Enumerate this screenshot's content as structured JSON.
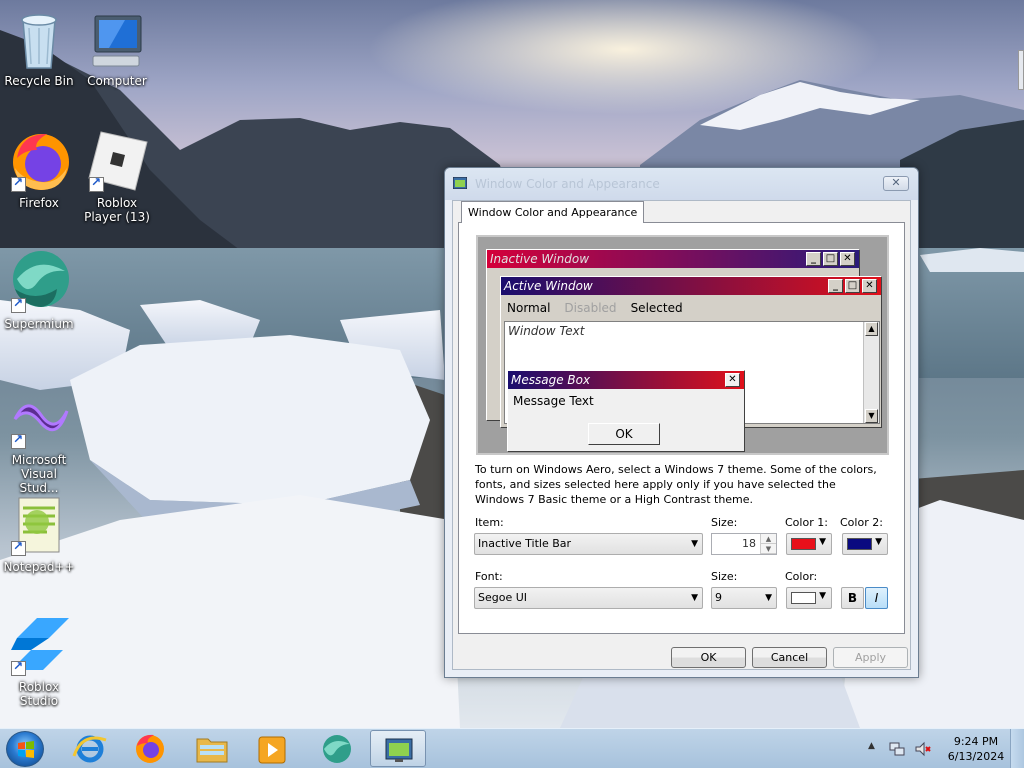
{
  "desktop": {
    "icons": [
      {
        "label": "Recycle Bin"
      },
      {
        "label": "Computer"
      },
      {
        "label": "Firefox"
      },
      {
        "label": "Roblox Player (13)"
      },
      {
        "label": "Supermium"
      },
      {
        "label": "Microsoft Visual Stud..."
      },
      {
        "label": "Notepad++"
      },
      {
        "label": "Roblox Studio"
      }
    ]
  },
  "dialog": {
    "title": "Window Color and Appearance",
    "tab_label": "Window Color and Appearance",
    "close_glyph": "✕",
    "preview": {
      "inactive_title": "Inactive Window",
      "active_title": "Active Window",
      "menu_normal": "Normal",
      "menu_disabled": "Disabled",
      "menu_selected": "Selected",
      "window_text": "Window Text",
      "message_box_title": "Message Box",
      "message_text": "Message Text",
      "ok_label": "OK",
      "colors": {
        "inactive_left": "#d4003a",
        "inactive_right": "#2a1b7a",
        "active_left": "#1a0e6e",
        "active_right": "#e0101a"
      }
    },
    "note": "To turn on Windows Aero, select a Windows 7 theme.  Some of the colors, fonts, and sizes selected here apply only if you have selected the Windows 7 Basic theme or a High Contrast theme.",
    "item_label": "Item:",
    "item_value": "Inactive Title Bar",
    "item_size_label": "Size:",
    "item_size_value": "18",
    "color1_label": "Color 1:",
    "color1_value": "#e8101a",
    "color2_label": "Color 2:",
    "color2_value": "#0a0a80",
    "font_label": "Font:",
    "font_value": "Segoe UI",
    "font_size_label": "Size:",
    "font_size_value": "9",
    "font_color_label": "Color:",
    "font_color_value": "#ffffff",
    "bold_label": "B",
    "italic_label": "I",
    "ok_button": "OK",
    "cancel_button": "Cancel",
    "apply_button": "Apply"
  },
  "taskbar": {
    "pinned": [
      "internet-explorer",
      "firefox",
      "file-explorer",
      "media-player",
      "supermium",
      "window-color"
    ],
    "clock_time": "9:24 PM",
    "clock_date": "6/13/2024"
  }
}
